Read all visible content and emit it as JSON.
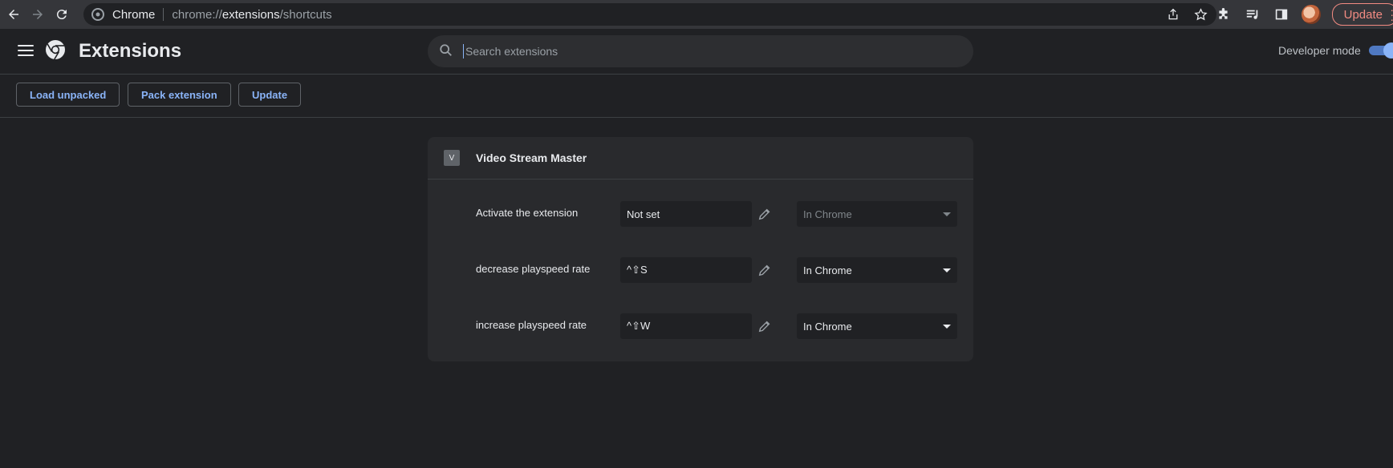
{
  "browser": {
    "site_name": "Chrome",
    "url_prefix": "chrome://",
    "url_host": "extensions",
    "url_path": "/shortcuts",
    "update_label": "Update"
  },
  "header": {
    "title": "Extensions",
    "search_placeholder": "Search extensions",
    "developer_mode_label": "Developer mode",
    "developer_mode_on": true
  },
  "actions": {
    "load_unpacked": "Load unpacked",
    "pack_extension": "Pack extension",
    "update": "Update"
  },
  "extension": {
    "icon_letter": "V",
    "name": "Video Stream Master",
    "shortcuts": [
      {
        "label": "Activate the extension",
        "shortcut": "Not set",
        "scope": "In Chrome",
        "scope_disabled": true
      },
      {
        "label": "decrease playspeed rate",
        "shortcut": "^⇧S",
        "scope": "In Chrome",
        "scope_disabled": false
      },
      {
        "label": "increase playspeed rate",
        "shortcut": "^⇧W",
        "scope": "In Chrome",
        "scope_disabled": false
      }
    ]
  }
}
